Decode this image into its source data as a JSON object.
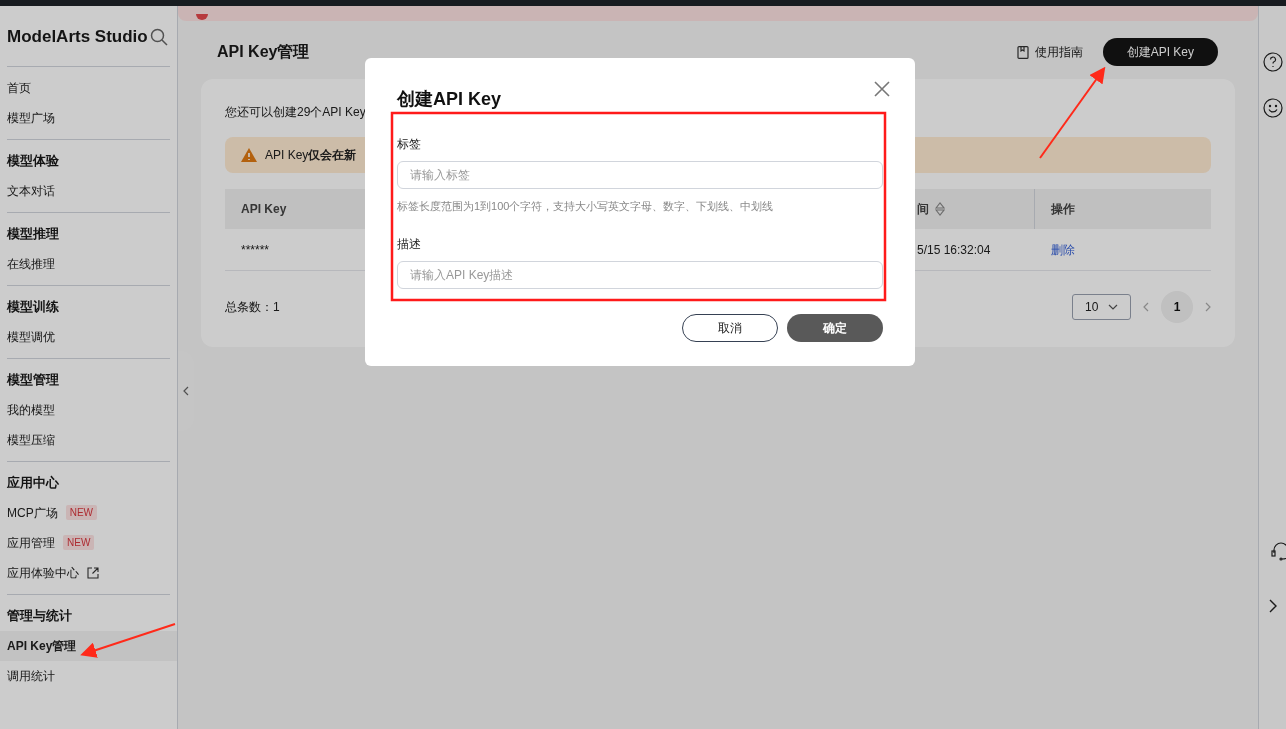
{
  "sidebar": {
    "title": "ModelArts Studio",
    "sections": [
      {
        "items": [
          {
            "label": "首页",
            "selected": false
          },
          {
            "label": "模型广场",
            "selected": false
          }
        ]
      },
      {
        "heading": "模型体验",
        "items": [
          {
            "label": "文本对话",
            "selected": false
          }
        ]
      },
      {
        "heading": "模型推理",
        "items": [
          {
            "label": "在线推理",
            "selected": false
          }
        ]
      },
      {
        "heading": "模型训练",
        "items": [
          {
            "label": "模型调优",
            "selected": false
          }
        ]
      },
      {
        "heading": "模型管理",
        "items": [
          {
            "label": "我的模型",
            "selected": false
          },
          {
            "label": "模型压缩",
            "selected": false
          }
        ]
      },
      {
        "heading": "应用中心",
        "items": [
          {
            "label": "MCP广场",
            "selected": false,
            "badge": "NEW"
          },
          {
            "label": "应用管理",
            "selected": false,
            "badge": "NEW"
          },
          {
            "label": "应用体验中心",
            "selected": false,
            "external": true
          }
        ]
      },
      {
        "heading": "管理与统计",
        "items": [
          {
            "label": "API Key管理",
            "selected": true
          },
          {
            "label": "调用统计",
            "selected": false
          }
        ]
      }
    ]
  },
  "page": {
    "title": "API Key管理",
    "guide_link": "使用指南",
    "create_button": "创建API Key"
  },
  "card": {
    "quota_text": "您还可以创建29个API Key",
    "warning": "API Key**仅会在新**",
    "table": {
      "columns": [
        "API Key",
        "间",
        "操作"
      ],
      "rows": [
        {
          "api_key": "******",
          "time": "5/15 16:32:04",
          "action": "删除"
        }
      ]
    },
    "total": "总条数：1",
    "page_size": "10",
    "pages": [
      {
        "label": "1",
        "selected": true
      }
    ]
  },
  "dialog": {
    "title": "创建API Key",
    "fields": [
      {
        "label": "标签",
        "placeholder": "请输入标签",
        "hint": "标签长度范围为1到100个字符，支持大小写英文字母、数字、下划线、中划线"
      },
      {
        "label": "描述",
        "placeholder": "请输入API Key描述"
      }
    ],
    "cancel": "取消",
    "confirm": "确定"
  }
}
